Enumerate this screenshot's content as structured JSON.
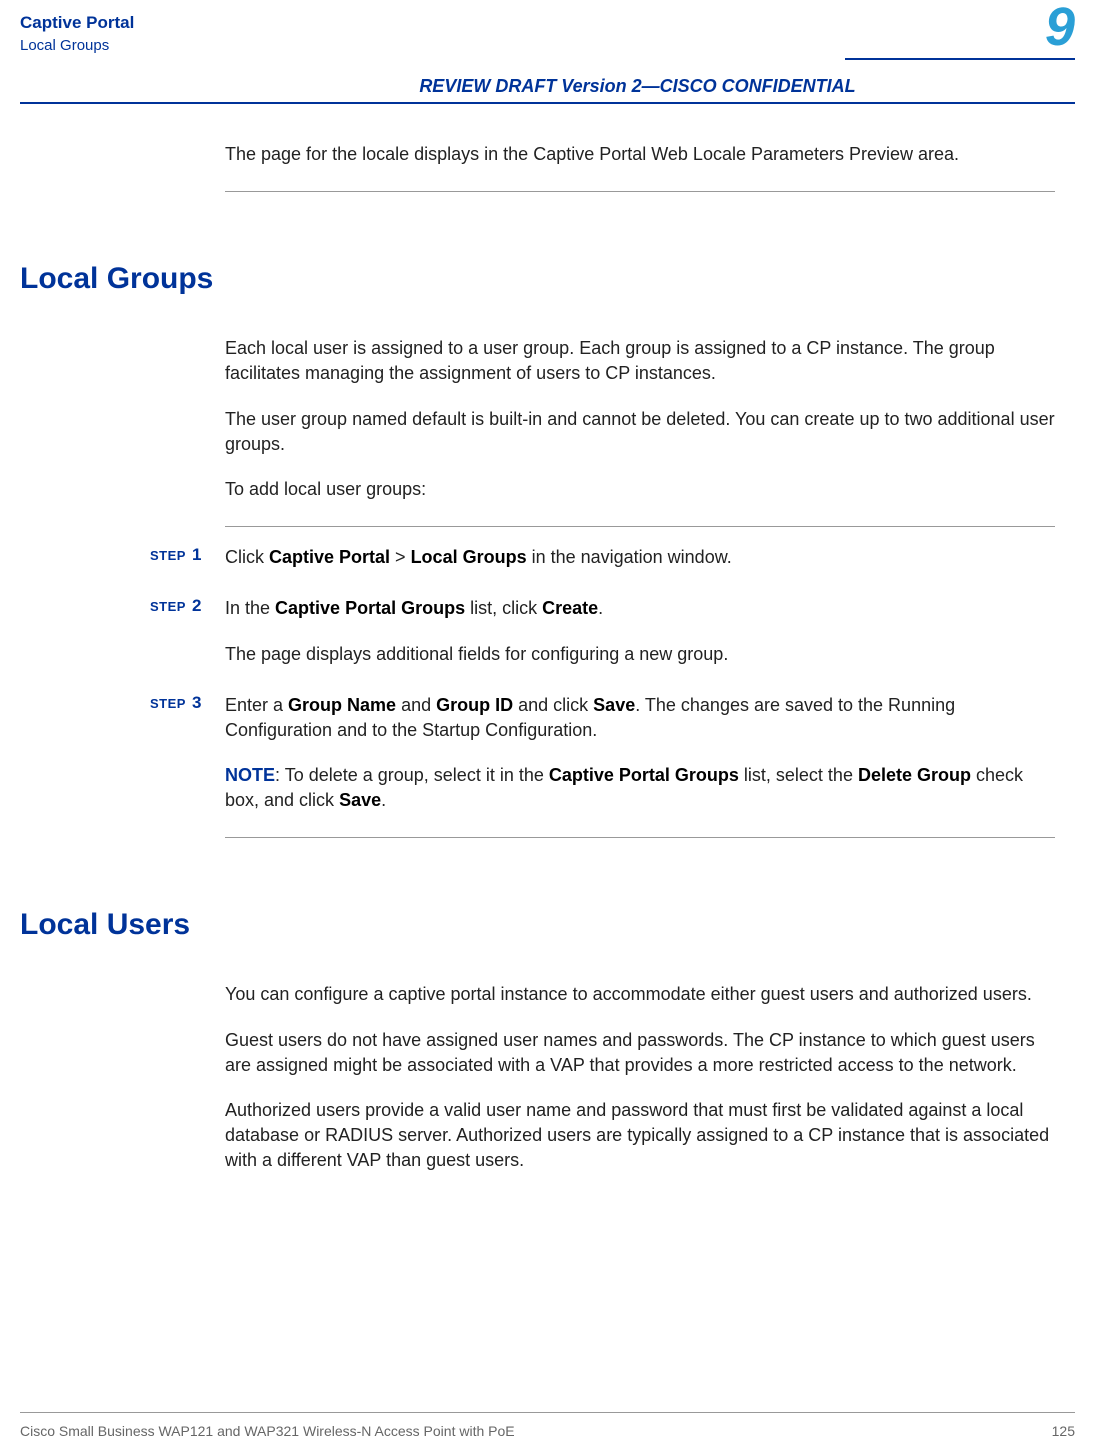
{
  "header": {
    "chapter_title": "Captive Portal",
    "section": "Local Groups",
    "chapter_number": "9",
    "review_banner": "REVIEW DRAFT  Version 2—CISCO CONFIDENTIAL"
  },
  "intro": "The page for the locale displays in the Captive Portal Web Locale Parameters Preview area.",
  "local_groups": {
    "heading": "Local Groups",
    "p1": "Each local user is assigned to a user group. Each group is assigned to a CP instance. The group facilitates managing the assignment of users to CP instances.",
    "p2_a": "The user group named ",
    "p2_b": "default",
    "p2_c": " is built-in and cannot be deleted. You can create up to two additional user groups.",
    "p3": "To add local user groups:",
    "steps": {
      "label": "STEP",
      "s1_a": "Click ",
      "s1_b": "Captive Portal",
      "s1_c": " > ",
      "s1_d": "Local Groups",
      "s1_e": " in the navigation window.",
      "s2_a": "In the ",
      "s2_b": "Captive Portal Groups",
      "s2_c": " list, click ",
      "s2_d": "Create",
      "s2_e": ".",
      "s2_sub": "The page displays additional fields for configuring a new group.",
      "s3_a": "Enter a ",
      "s3_b": "Group Name",
      "s3_c": " and ",
      "s3_d": "Group ID",
      "s3_e": " and click ",
      "s3_f": "Save",
      "s3_g": ". The changes are saved to the Running Configuration and to the Startup Configuration.",
      "note_label": "NOTE",
      "note_a": ": To delete a group, select it in the ",
      "note_b": "Captive Portal Groups",
      "note_c": " list, select the ",
      "note_d": "Delete Group",
      "note_e": " check box, and click ",
      "note_f": "Save",
      "note_g": "."
    }
  },
  "local_users": {
    "heading": "Local Users",
    "p1": "You can configure a captive portal instance to accommodate either guest users and authorized users.",
    "p2": "Guest users do not have assigned user names and passwords. The CP instance to which guest users are assigned might be associated with a VAP that provides a more restricted access to the network.",
    "p3": "Authorized users provide a valid user name and password that must first be validated against a local database or RADIUS server. Authorized users are typically assigned to a CP instance that is associated with a different VAP than guest users."
  },
  "footer": {
    "left": "Cisco Small Business WAP121 and WAP321 Wireless-N Access Point with PoE",
    "right": "125"
  }
}
